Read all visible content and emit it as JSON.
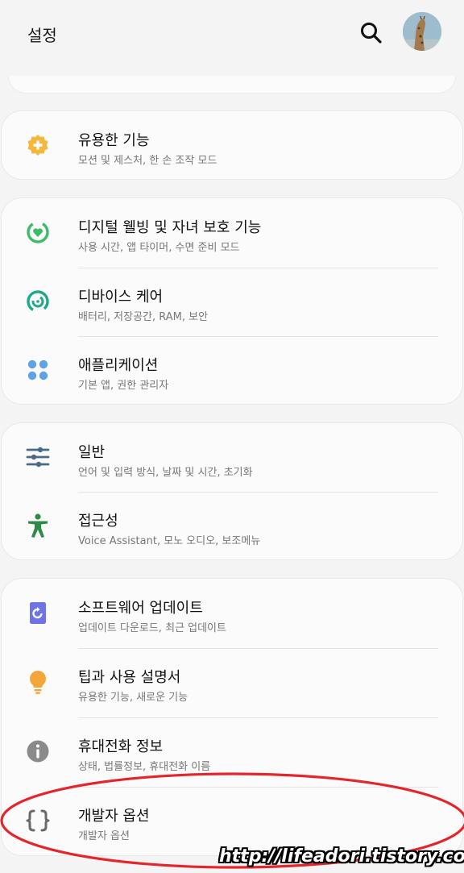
{
  "header": {
    "title": "설정"
  },
  "sections": [
    {
      "items": [
        {
          "title": "유용한 기능",
          "sub": "모션 및 제스처, 한 손 조작 모드",
          "icon": "plus-gear-icon",
          "color": "#f5b73b"
        }
      ]
    },
    {
      "items": [
        {
          "title": "디지털 웰빙 및 자녀 보호 기능",
          "sub": "사용 시간, 앱 타이머, 수면 준비 모드",
          "icon": "wellbeing-heart-icon",
          "color": "#3dbb6a"
        },
        {
          "title": "디바이스 케어",
          "sub": "배터리, 저장공간, RAM, 보안",
          "icon": "device-care-icon",
          "color": "#1fa88a"
        },
        {
          "title": "애플리케이션",
          "sub": "기본 앱, 권한 관리자",
          "icon": "apps-grid-icon",
          "color": "#5ea3e8"
        }
      ]
    },
    {
      "items": [
        {
          "title": "일반",
          "sub": "언어 및 입력 방식, 날짜 및 시간, 초기화",
          "icon": "sliders-icon",
          "color": "#4a6a86"
        },
        {
          "title": "접근성",
          "sub": "Voice Assistant, 모노 오디오, 보조메뉴",
          "icon": "accessibility-icon",
          "color": "#2f8a47"
        }
      ]
    },
    {
      "items": [
        {
          "title": "소프트웨어 업데이트",
          "sub": "업데이트 다운로드, 최근 업데이트",
          "icon": "software-update-icon",
          "color": "#6f73e8"
        },
        {
          "title": "팁과 사용 설명서",
          "sub": "유용한 기능, 새로운 기능",
          "icon": "lightbulb-icon",
          "color": "#f5a63b"
        },
        {
          "title": "휴대전화 정보",
          "sub": "상태, 법률정보, 휴대전화 이름",
          "icon": "info-icon",
          "color": "#8a8a8a"
        },
        {
          "title": "개발자 옵션",
          "sub": "개발자 옵션",
          "icon": "braces-icon",
          "color": "#6a6a6a"
        }
      ]
    }
  ],
  "annotation": {
    "highlight_color": "#e3262c"
  },
  "watermark": "http://lifeadori.tistory.com"
}
